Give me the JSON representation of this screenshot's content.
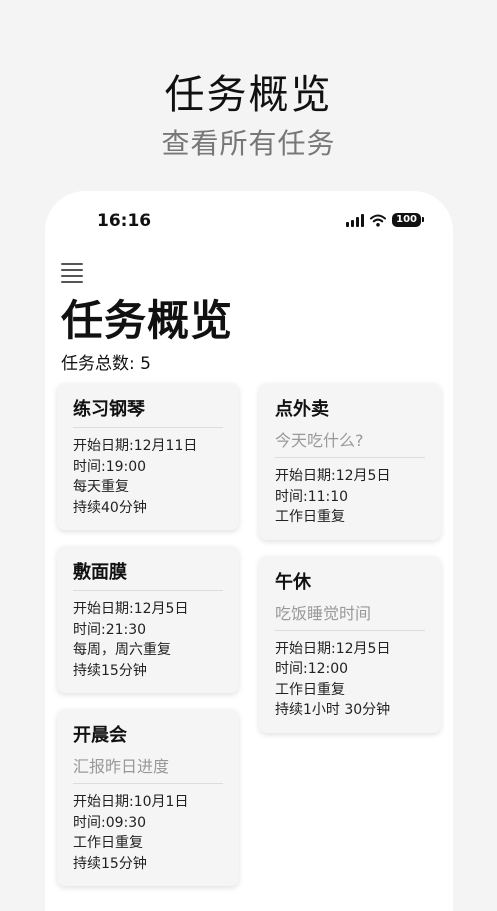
{
  "promo": {
    "title": "任务概览",
    "subtitle": "查看所有任务"
  },
  "status_bar": {
    "time": "16:16",
    "battery": "100"
  },
  "page": {
    "title": "任务概览",
    "task_count": "任务总数: 5"
  },
  "tasks_left": [
    {
      "title": "练习钢琴",
      "subtitle": "",
      "lines": [
        "开始日期:12月11日",
        "时间:19:00",
        "每天重复",
        "持续40分钟"
      ]
    },
    {
      "title": "敷面膜",
      "subtitle": "",
      "lines": [
        "开始日期:12月5日",
        "时间:21:30",
        " 每周，周六重复",
        "持续15分钟"
      ]
    },
    {
      "title": "开晨会",
      "subtitle": "汇报昨日进度",
      "lines": [
        "开始日期:10月1日",
        "时间:09:30",
        "工作日重复",
        "持续15分钟"
      ]
    }
  ],
  "tasks_right": [
    {
      "title": "点外卖",
      "subtitle": "今天吃什么?",
      "lines": [
        "开始日期:12月5日",
        "时间:11:10",
        "工作日重复"
      ]
    },
    {
      "title": "午休",
      "subtitle": "吃饭睡觉时间",
      "lines": [
        "开始日期:12月5日",
        "时间:12:00",
        "工作日重复",
        "持续1小时 30分钟"
      ]
    }
  ]
}
